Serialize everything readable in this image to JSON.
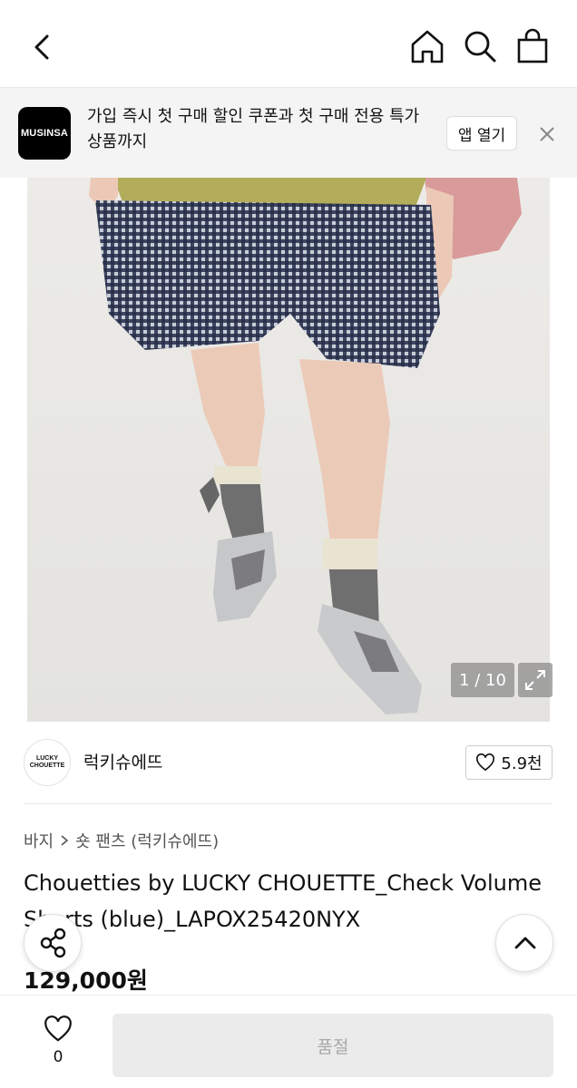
{
  "header": {
    "back_icon": "chevron-left-icon",
    "home_icon": "home-icon",
    "search_icon": "search-icon",
    "bag_icon": "shopping-bag-icon"
  },
  "banner": {
    "logo_text": "MUSINSA",
    "message": "가입 즉시 첫 구매 할인 쿠폰과 첫 구매 전용 특가 상품까지",
    "app_button": "앱 열기",
    "close_icon": "close-icon"
  },
  "gallery": {
    "counter": "1 / 10",
    "expand_icon": "expand-icon"
  },
  "brand": {
    "logo_line1": "LUCKY",
    "logo_line2": "CHOUETTE",
    "name": "럭키슈에뜨",
    "likes": "5.9천"
  },
  "product": {
    "breadcrumb": [
      "바지",
      "숏 팬츠 (럭키슈에뜨)"
    ],
    "title": "Chouetties by LUCKY CHOUETTE_Check Volume Shorts (blue)_LAPOX25420NYX",
    "price": "129,000원"
  },
  "bottom_bar": {
    "wish_count": "0",
    "buy_button": "품절"
  },
  "colors": {
    "banner_bg": "#f4f4f4",
    "soldout_bg": "#ebebeb",
    "soldout_text": "#a8a8a8"
  }
}
